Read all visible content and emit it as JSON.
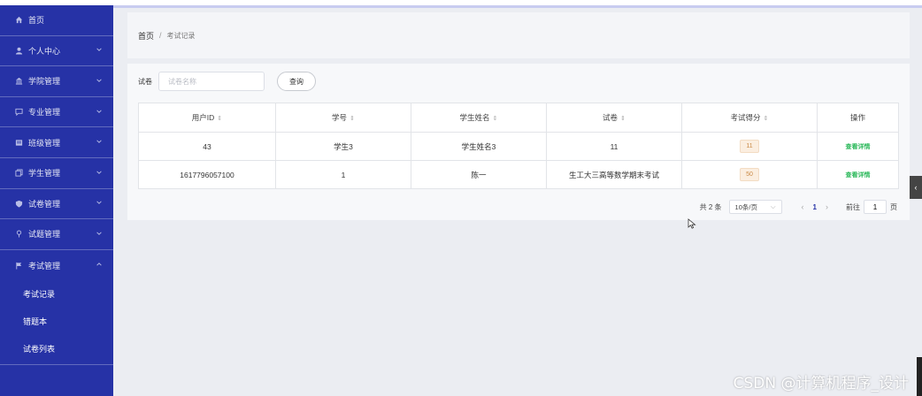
{
  "sidebar": {
    "items": [
      {
        "label": "首页",
        "icon": "home-icon",
        "expandable": false
      },
      {
        "label": "个人中心",
        "icon": "user-icon",
        "expandable": true
      },
      {
        "label": "学院管理",
        "icon": "bank-icon",
        "expandable": true
      },
      {
        "label": "专业管理",
        "icon": "comment-icon",
        "expandable": true
      },
      {
        "label": "班级管理",
        "icon": "folder-icon",
        "expandable": true
      },
      {
        "label": "学生管理",
        "icon": "copy-icon",
        "expandable": true
      },
      {
        "label": "试卷管理",
        "icon": "shield-icon",
        "expandable": true
      },
      {
        "label": "试题管理",
        "icon": "pin-icon",
        "expandable": true
      },
      {
        "label": "考试管理",
        "icon": "flag-icon",
        "expandable": true,
        "expanded": true
      }
    ],
    "subitems": [
      "考试记录",
      "错题本",
      "试卷列表"
    ]
  },
  "breadcrumb": {
    "home": "首页",
    "separator": "/",
    "current": "考试记录"
  },
  "search": {
    "label": "试卷",
    "placeholder": "试卷名称",
    "button": "查询"
  },
  "table": {
    "headers": [
      "用户ID",
      "学号",
      "学生姓名",
      "试卷",
      "考试得分",
      "操作"
    ],
    "rows": [
      {
        "user_id": "43",
        "student_no": "学生3",
        "student_name": "学生姓名3",
        "paper": "11",
        "score": "11",
        "action": "查看详情"
      },
      {
        "user_id": "1617796057100",
        "student_no": "1",
        "student_name": "陈一",
        "paper": "生工大三高等数学期末考试",
        "score": "50",
        "action": "查看详情"
      }
    ]
  },
  "pagination": {
    "total": "共 2 条",
    "page_size": "10条/页",
    "current_page": "1",
    "goto_label": "前往",
    "goto_value": "1",
    "page_suffix": "页"
  },
  "watermark": "CSDN @计算机程序_设计",
  "colors": {
    "sidebar": "#2632a6",
    "accent": "#2632a6",
    "score_badge": "#fbeee0",
    "detail_link": "#2bb85a"
  }
}
